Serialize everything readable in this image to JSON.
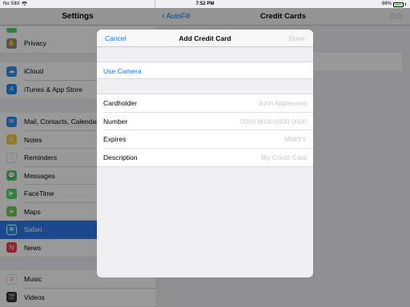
{
  "status": {
    "carrier": "No SIM",
    "time": "7:52 PM",
    "battery": "86%",
    "battery_level": 0.86
  },
  "master": {
    "title": "Settings",
    "groups": [
      {
        "items": [
          {
            "label": "Privacy",
            "icon": "hand-icon",
            "color": "#8e8e93"
          }
        ]
      },
      {
        "items": [
          {
            "label": "iCloud",
            "icon": "cloud-icon",
            "color": "#3a8ee6"
          },
          {
            "label": "iTunes & App Store",
            "icon": "app-store-icon",
            "color": "#1a87f5"
          }
        ]
      },
      {
        "items": [
          {
            "label": "Mail, Contacts, Calendars",
            "icon": "mail-icon",
            "color": "#2c8af2"
          },
          {
            "label": "Notes",
            "icon": "notes-icon",
            "color": "#f5c84c"
          },
          {
            "label": "Reminders",
            "icon": "reminders-icon",
            "color": "#ffffff"
          },
          {
            "label": "Messages",
            "icon": "messages-icon",
            "color": "#4cd964"
          },
          {
            "label": "FaceTime",
            "icon": "facetime-icon",
            "color": "#4cd964"
          },
          {
            "label": "Maps",
            "icon": "maps-icon",
            "color": "#7cc75b"
          },
          {
            "label": "Safari",
            "icon": "safari-icon",
            "color": "#1a8cf0",
            "selected": true
          },
          {
            "label": "News",
            "icon": "news-icon",
            "color": "#f23b4d"
          }
        ]
      },
      {
        "items": [
          {
            "label": "Music",
            "icon": "music-icon",
            "color": "#ffffff"
          },
          {
            "label": "Videos",
            "icon": "videos-icon",
            "color": "#2d2d2d"
          }
        ]
      }
    ]
  },
  "detail": {
    "back_label": "AutoFill",
    "title": "Credit Cards",
    "edit_label": "Edit"
  },
  "sheet": {
    "cancel_label": "Cancel",
    "title": "Add Credit Card",
    "done_label": "Done",
    "camera_label": "Use Camera",
    "fields": [
      {
        "label": "Cardholder",
        "placeholder": "John Appleseed",
        "value": ""
      },
      {
        "label": "Number",
        "placeholder": "0000 0000 0000 0000",
        "value": ""
      },
      {
        "label": "Expires",
        "placeholder": "MM/YY",
        "value": ""
      },
      {
        "label": "Description",
        "placeholder": "My Credit Card",
        "value": ""
      }
    ]
  },
  "colors": {
    "accent": "#007aff",
    "selection": "#2f7bea",
    "disabled": "#c7c7cc"
  }
}
